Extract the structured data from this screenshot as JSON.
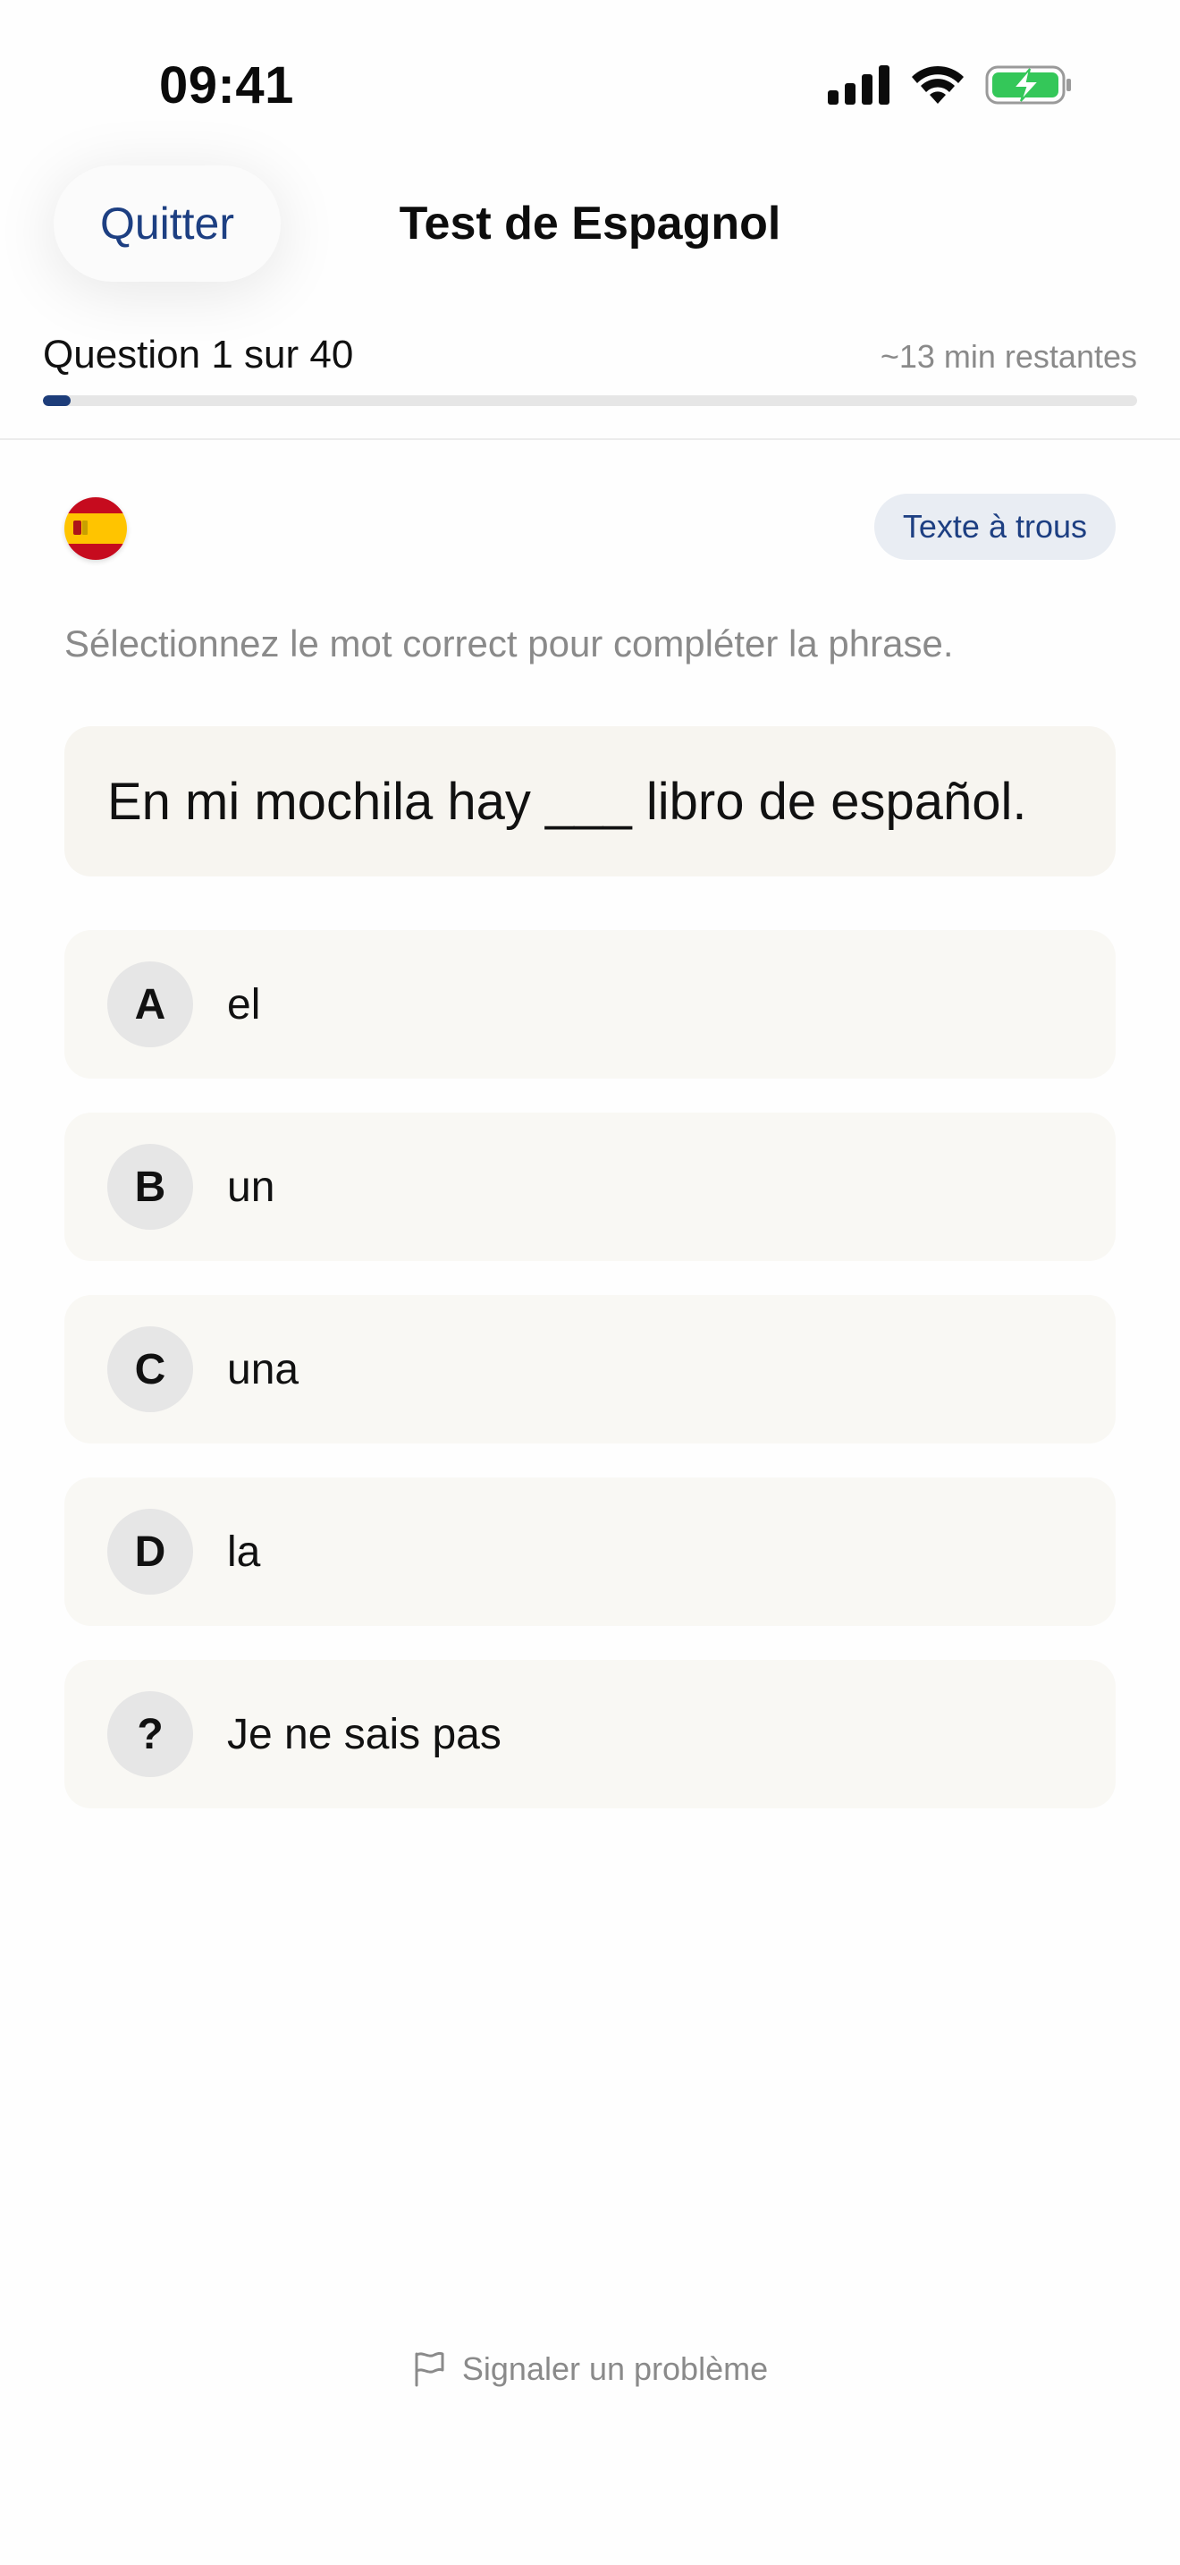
{
  "status_bar": {
    "time": "09:41",
    "icons": [
      "signal-icon",
      "wifi-icon",
      "battery-charging-icon"
    ],
    "battery_color": "#34c759"
  },
  "header": {
    "quit_label": "Quitter",
    "title": "Test de Espagnol"
  },
  "progress": {
    "counter": "Question 1 sur 40",
    "time_remaining": "~13 min restantes",
    "current": 1,
    "total": 40,
    "fill_color": "#1d3d7a"
  },
  "question": {
    "flag": "spain-flag-icon",
    "type_badge": "Texte à trous",
    "instruction": "Sélectionnez le mot correct pour compléter la phrase.",
    "sentence": "En mi mochila hay ___ libro de español."
  },
  "options": [
    {
      "letter": "A",
      "text": "el"
    },
    {
      "letter": "B",
      "text": "un"
    },
    {
      "letter": "C",
      "text": "una"
    },
    {
      "letter": "D",
      "text": "la"
    },
    {
      "letter": "?",
      "text": "Je ne sais pas"
    }
  ],
  "footer": {
    "report_label": "Signaler un problème",
    "report_icon": "flag-outline-icon"
  }
}
